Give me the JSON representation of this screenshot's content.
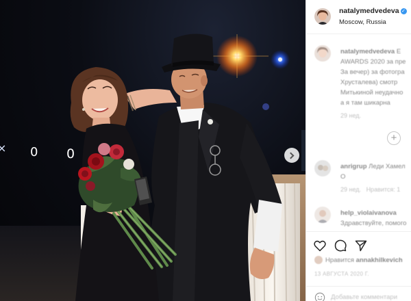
{
  "post_header": {
    "username": "natalymedvedeva",
    "location": "Moscow, Russia"
  },
  "caption": {
    "username": "natalymedvedeva",
    "lines": [
      "AWARDS 2020 за пре",
      "За вечер) за фотогра",
      "Хрусталева) смотр",
      "Митькиной неудачно",
      "а я там шикарна"
    ],
    "badge": "E",
    "time": "29 нед."
  },
  "comments": [
    {
      "username": "anrigrup",
      "text": "Леди Хамел",
      "time": "29 нед.",
      "likes": "Нравится: 1",
      "reply": "О"
    },
    {
      "username": "help_violaivanova",
      "text": "Здравствуйте, помого"
    }
  ],
  "likes_line": {
    "prefix": "Нравится",
    "user": "annakhilkevich"
  },
  "date": "13 АВГУСТА 2020 Г.",
  "add_comment_placeholder": "Добавьте комментари",
  "photo": {
    "neon_digit_1": "0",
    "neon_digit_2": "0"
  },
  "icons": [
    "verified-icon",
    "heart-icon",
    "comment-icon",
    "share-icon",
    "emoji-icon",
    "next-arrow-icon",
    "load-more-icon"
  ],
  "colors": {
    "accent": "#3897f0",
    "meta_text": "#8e8e8e",
    "text": "#262626"
  }
}
